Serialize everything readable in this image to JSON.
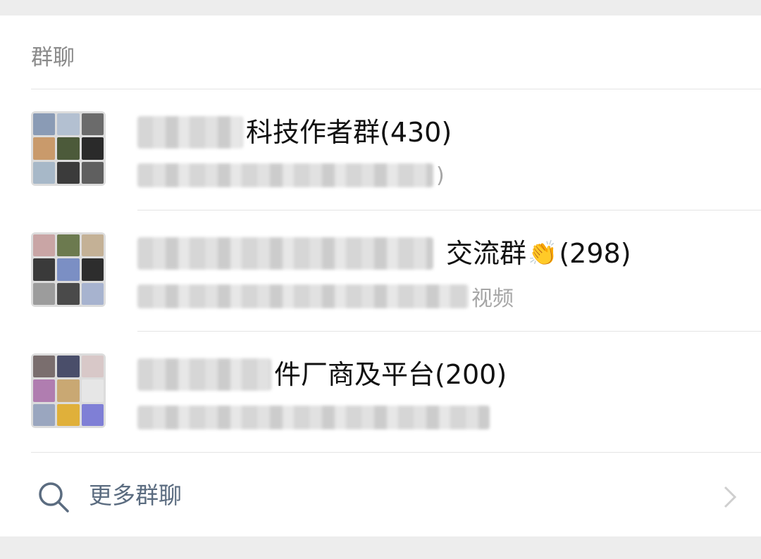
{
  "section": {
    "title": "群聊"
  },
  "groups": [
    {
      "name_visible": "科技作者群(430)",
      "subtitle_visible": ")",
      "avatar_colors": [
        "#8a9bb5",
        "#b3c0d1",
        "#6b6b6b",
        "#c99a6b",
        "#4c5a3a",
        "#2a2a2a",
        "#a7b8c8",
        "#3b3b3b",
        "#5f5f5f"
      ]
    },
    {
      "name_visible": "交流群",
      "emoji": "👏",
      "count": "(298)",
      "subtitle_visible": "视频",
      "avatar_colors": [
        "#c9a5a5",
        "#6c7a4f",
        "#c4b196",
        "#3a3a3a",
        "#7b8fc4",
        "#2d2d2d",
        "#9c9c9c",
        "#4a4a4a",
        "#a7b3cf"
      ]
    },
    {
      "name_visible": "件厂商及平台(200)",
      "subtitle_visible": "",
      "avatar_colors": [
        "#7a6e6e",
        "#4a4e6a",
        "#d8c8c8",
        "#b07db0",
        "#c9a873",
        "#e6e6e6",
        "#9aa6bf",
        "#e0b03a",
        "#7f7fd6"
      ]
    }
  ],
  "more": {
    "label": "更多群聊"
  }
}
